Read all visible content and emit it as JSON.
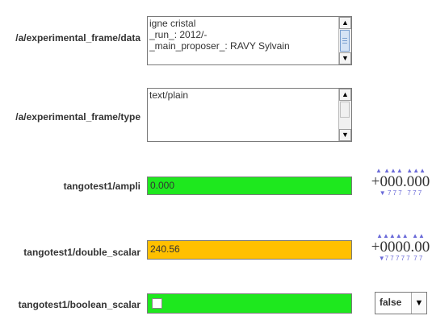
{
  "attributes": {
    "data": {
      "label": "/a/experimental_frame/data",
      "lines": [
        "igne cristal",
        "_run_: 2012/-",
        "_main_proposer_: RAVY Sylvain"
      ]
    },
    "type": {
      "label": "/a/experimental_frame/type",
      "lines": [
        "text/plain"
      ]
    },
    "ampli": {
      "label": "tangotest1/ampli",
      "value": "0.000",
      "wheel_up": "▲ ▲▲▲  ▲▲▲",
      "wheel_value": "+000.000",
      "wheel_down": "▼ 7 7 7   7 7 7",
      "color": "#1ee81e"
    },
    "double_scalar": {
      "label": "tangotest1/double_scalar",
      "value": "240.56",
      "wheel_up": "▲▲▲▲▲  ▲▲",
      "wheel_value": "+0000.00",
      "wheel_down": "▼7 7 7 7 7  7 7",
      "color": "#ffc000"
    },
    "boolean_scalar": {
      "label": "tangotest1/boolean_scalar",
      "checked": false,
      "color": "#1ee81e",
      "combo_value": "false"
    }
  },
  "icons": {
    "scroll_up": "▲",
    "scroll_down": "▼",
    "combo_arrow": "▼"
  }
}
